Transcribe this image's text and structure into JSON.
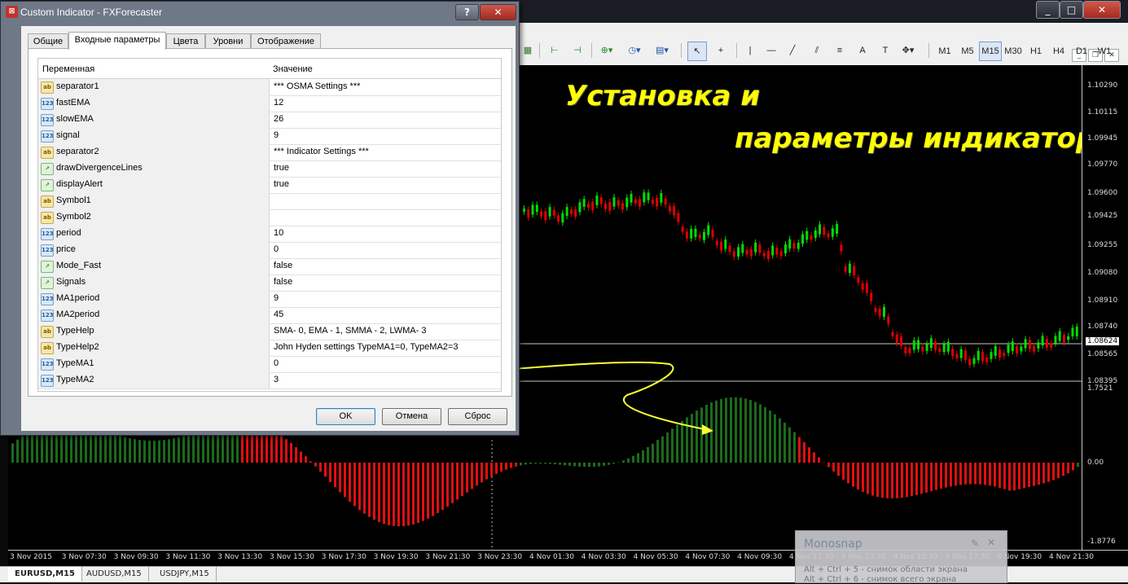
{
  "window": {
    "title": "Custom Indicator - FXForecaster"
  },
  "dialog": {
    "title": "Custom Indicator - FXForecaster",
    "tabs": [
      "Общие",
      "Входные параметры",
      "Цвета",
      "Уровни",
      "Отображение"
    ],
    "active_tab": "Входные параметры",
    "columns": {
      "variable": "Переменная",
      "value": "Значение"
    },
    "params": [
      {
        "type": "ab",
        "name": "separator1",
        "value": "*** OSMA Settings ***"
      },
      {
        "type": "123",
        "name": "fastEMA",
        "value": "12"
      },
      {
        "type": "123",
        "name": "slowEMA",
        "value": "26"
      },
      {
        "type": "123",
        "name": "signal",
        "value": "9"
      },
      {
        "type": "ab",
        "name": "separator2",
        "value": "*** Indicator Settings ***"
      },
      {
        "type": "bool",
        "name": "drawDivergenceLines",
        "value": "true"
      },
      {
        "type": "bool",
        "name": "displayAlert",
        "value": "true"
      },
      {
        "type": "ab",
        "name": "Symbol1",
        "value": ""
      },
      {
        "type": "ab",
        "name": "Symbol2",
        "value": ""
      },
      {
        "type": "123",
        "name": "period",
        "value": "10"
      },
      {
        "type": "123",
        "name": "price",
        "value": "0"
      },
      {
        "type": "bool",
        "name": "Mode_Fast",
        "value": "false"
      },
      {
        "type": "bool",
        "name": "Signals",
        "value": "false"
      },
      {
        "type": "123",
        "name": "MA1period",
        "value": "9"
      },
      {
        "type": "123",
        "name": "MA2period",
        "value": "45"
      },
      {
        "type": "ab",
        "name": "TypeHelp",
        "value": "SMA- 0, EMA - 1, SMMA - 2, LWMA- 3"
      },
      {
        "type": "ab",
        "name": "TypeHelp2",
        "value": "John Hyden settings TypeMA1=0, TypeMA2=3"
      },
      {
        "type": "123",
        "name": "TypeMA1",
        "value": "0"
      },
      {
        "type": "123",
        "name": "TypeMA2",
        "value": "3"
      }
    ],
    "icon_labels": {
      "ab": "ab",
      "123": "123",
      "bool": "↗"
    },
    "buttons": {
      "ok": "OK",
      "cancel": "Отмена",
      "reset": "Сброс"
    },
    "help_glyph": "?",
    "close_glyph": "✕"
  },
  "toolbar": {
    "timeframes": [
      "M1",
      "M5",
      "M15",
      "M30",
      "H1",
      "H4",
      "D1",
      "W1"
    ],
    "active_timeframe": "M15"
  },
  "overlay": {
    "line1": "Установка и",
    "line2": "параметры индикатора"
  },
  "price_axis": {
    "labels": [
      "1.10290",
      "1.10115",
      "1.09945",
      "1.09770",
      "1.09600",
      "1.09425",
      "1.09255",
      "1.09080",
      "1.08910",
      "1.08740",
      "1.08565",
      "1.08395"
    ],
    "current": "1.08624",
    "osc_labels": [
      "1.7521",
      "0.00",
      "-1.8776"
    ]
  },
  "time_axis": [
    "3 Nov 2015",
    "3 Nov 07:30",
    "3 Nov 09:30",
    "3 Nov 11:30",
    "3 Nov 13:30",
    "3 Nov 15:30",
    "3 Nov 17:30",
    "3 Nov 19:30",
    "3 Nov 21:30",
    "3 Nov 23:30",
    "4 Nov 01:30",
    "4 Nov 03:30",
    "4 Nov 05:30",
    "4 Nov 07:30",
    "4 Nov 09:30",
    "4 Nov 11:30",
    "4 Nov 13:30",
    "4 Nov 15:30",
    "4 Nov 17:30",
    "4 Nov 19:30",
    "4 Nov 21:30"
  ],
  "chart_tabs": [
    "EURUSD,M15",
    "AUDUSD,M15",
    "USDJPY,M15"
  ],
  "active_chart_tab": "EURUSD,M15",
  "monosnap": {
    "title": "Monosnap",
    "line1": "Alt + Ctrl + 5 - снимок области экрана",
    "line2": "Alt + Ctrl + 6 - снимок всего экрана"
  },
  "colors": {
    "bull": "#00e000",
    "bear": "#e00000",
    "osc_pos": "#1c6b1c",
    "osc_neg": "#e01010",
    "overlay_text": "#ffff00"
  }
}
